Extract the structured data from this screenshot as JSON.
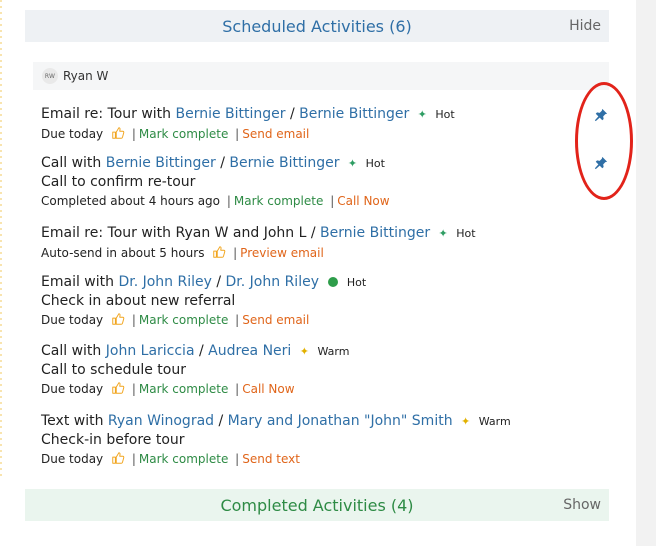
{
  "scheduled": {
    "title": "Scheduled Activities (6)",
    "action": "Hide"
  },
  "owner": {
    "initials": "RW",
    "name": "Ryan W"
  },
  "activities": [
    {
      "prefix": "Email re: Tour with",
      "contact": "Bernie Bittinger",
      "sep": "/",
      "lead": "Bernie Bittinger",
      "temperature": "Hot",
      "description": "",
      "status": "Due today",
      "action1": "Mark complete",
      "action2": "Send email",
      "pinned": true
    },
    {
      "prefix": "Call with",
      "contact": "Bernie Bittinger",
      "sep": "/",
      "lead": "Bernie Bittinger",
      "temperature": "Hot",
      "description": "Call to confirm re-tour",
      "status": "Completed about 4 hours ago",
      "action1": "Mark complete",
      "action2": "Call Now",
      "pinned": true
    },
    {
      "prefix": "Email re: Tour with Ryan W and John L",
      "contact": "",
      "sep": "/",
      "lead": "Bernie Bittinger",
      "temperature": "Hot",
      "description": "",
      "status": "Auto-send in about 5 hours",
      "action1": "Preview email",
      "action2": ""
    },
    {
      "prefix": "Email with",
      "contact": "Dr. John Riley",
      "sep": "/",
      "lead": "Dr. John Riley",
      "temperature": "Hot",
      "description": "Check in about new referral",
      "status": "Due today",
      "action1": "Mark complete",
      "action2": "Send email"
    },
    {
      "prefix": "Call with",
      "contact": "John Lariccia",
      "sep": "/",
      "lead": "Audrea Neri",
      "temperature": "Warm",
      "description": "Call to schedule tour",
      "status": "Due today",
      "action1": "Mark complete",
      "action2": "Call Now"
    },
    {
      "prefix": "Text with",
      "contact": "Ryan Winograd",
      "sep": "/",
      "lead": "Mary and Jonathan \"John\" Smith",
      "temperature": "Warm",
      "description": "Check-in before tour",
      "status": "Due today",
      "action1": "Mark complete",
      "action2": "Send text"
    }
  ],
  "completed": {
    "title": "Completed Activities (4)",
    "action": "Show"
  },
  "colors": {
    "link": "#2f6fa6",
    "action_green": "#2e8b45",
    "action_orange": "#e0651a",
    "annotation": "#e2231a"
  },
  "icons": {
    "pin": "pin-icon",
    "hot": "sparkle-hot-icon",
    "warm": "sparkle-warm-icon",
    "snooze": "thumbs-up-icon",
    "status_dot": "status-dot-icon"
  }
}
